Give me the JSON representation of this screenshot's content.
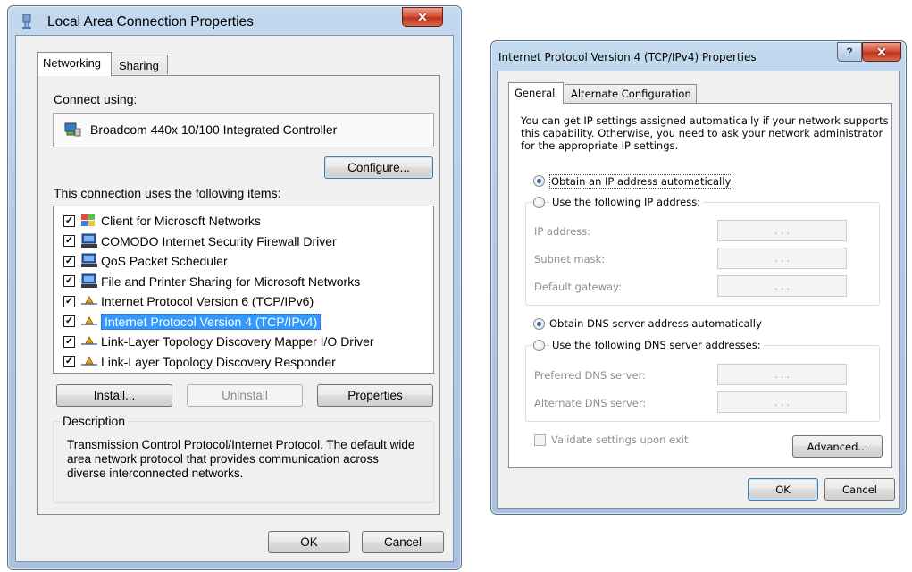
{
  "left_dialog": {
    "title": "Local Area Connection Properties",
    "close_glyph": "✕",
    "tabs": [
      {
        "label": "Networking",
        "active": true
      },
      {
        "label": "Sharing",
        "active": false
      }
    ],
    "connect_using_label": "Connect using:",
    "adapter_name": "Broadcom 440x 10/100 Integrated Controller",
    "configure_button": "Configure...",
    "items_heading": "This connection uses the following items:",
    "items": [
      {
        "label": "Client for Microsoft Networks",
        "checked": true,
        "icon": "network-client-icon",
        "selected": false
      },
      {
        "label": "COMODO Internet Security Firewall Driver",
        "checked": true,
        "icon": "network-service-icon",
        "selected": false
      },
      {
        "label": "QoS Packet Scheduler",
        "checked": true,
        "icon": "network-service-icon",
        "selected": false
      },
      {
        "label": "File and Printer Sharing for Microsoft Networks",
        "checked": true,
        "icon": "network-service-icon",
        "selected": false
      },
      {
        "label": "Internet Protocol Version 6 (TCP/IPv6)",
        "checked": true,
        "icon": "protocol-icon",
        "selected": false
      },
      {
        "label": "Internet Protocol Version 4 (TCP/IPv4)",
        "checked": true,
        "icon": "protocol-icon",
        "selected": true
      },
      {
        "label": "Link-Layer Topology Discovery Mapper I/O Driver",
        "checked": true,
        "icon": "protocol-icon",
        "selected": false
      },
      {
        "label": "Link-Layer Topology Discovery Responder",
        "checked": true,
        "icon": "protocol-icon",
        "selected": false
      }
    ],
    "install_button": "Install...",
    "uninstall_button": "Uninstall",
    "properties_button": "Properties",
    "description_legend": "Description",
    "description_text": "Transmission Control Protocol/Internet Protocol. The default wide area network protocol that provides communication across diverse interconnected networks.",
    "ok_button": "OK",
    "cancel_button": "Cancel"
  },
  "right_dialog": {
    "title": "Internet Protocol Version 4 (TCP/IPv4) Properties",
    "help_glyph": "?",
    "close_glyph": "✕",
    "tabs": [
      {
        "label": "General",
        "active": true
      },
      {
        "label": "Alternate Configuration",
        "active": false
      }
    ],
    "intro_lines": [
      "You can get IP settings assigned automatically if your network supports",
      "this capability. Otherwise, you need to ask your network administrator",
      "for the appropriate IP settings."
    ],
    "obtain_ip_auto": "Obtain an IP address automatically",
    "use_following_ip": "Use the following IP address:",
    "ip_address_label": "IP address:",
    "subnet_mask_label": "Subnet mask:",
    "default_gateway_label": "Default gateway:",
    "obtain_dns_auto": "Obtain DNS server address automatically",
    "use_following_dns": "Use the following DNS server addresses:",
    "preferred_dns_label": "Preferred DNS server:",
    "alternate_dns_label": "Alternate DNS server:",
    "ip_placeholder_dots": ". . .",
    "validate_label": "Validate settings upon exit",
    "advanced_button": "Advanced...",
    "ok_button": "OK",
    "cancel_button": "Cancel"
  },
  "colors": {
    "selection_blue": "#3399ff",
    "frame_blue": "#b4cbe6",
    "close_red": "#c0331a"
  }
}
